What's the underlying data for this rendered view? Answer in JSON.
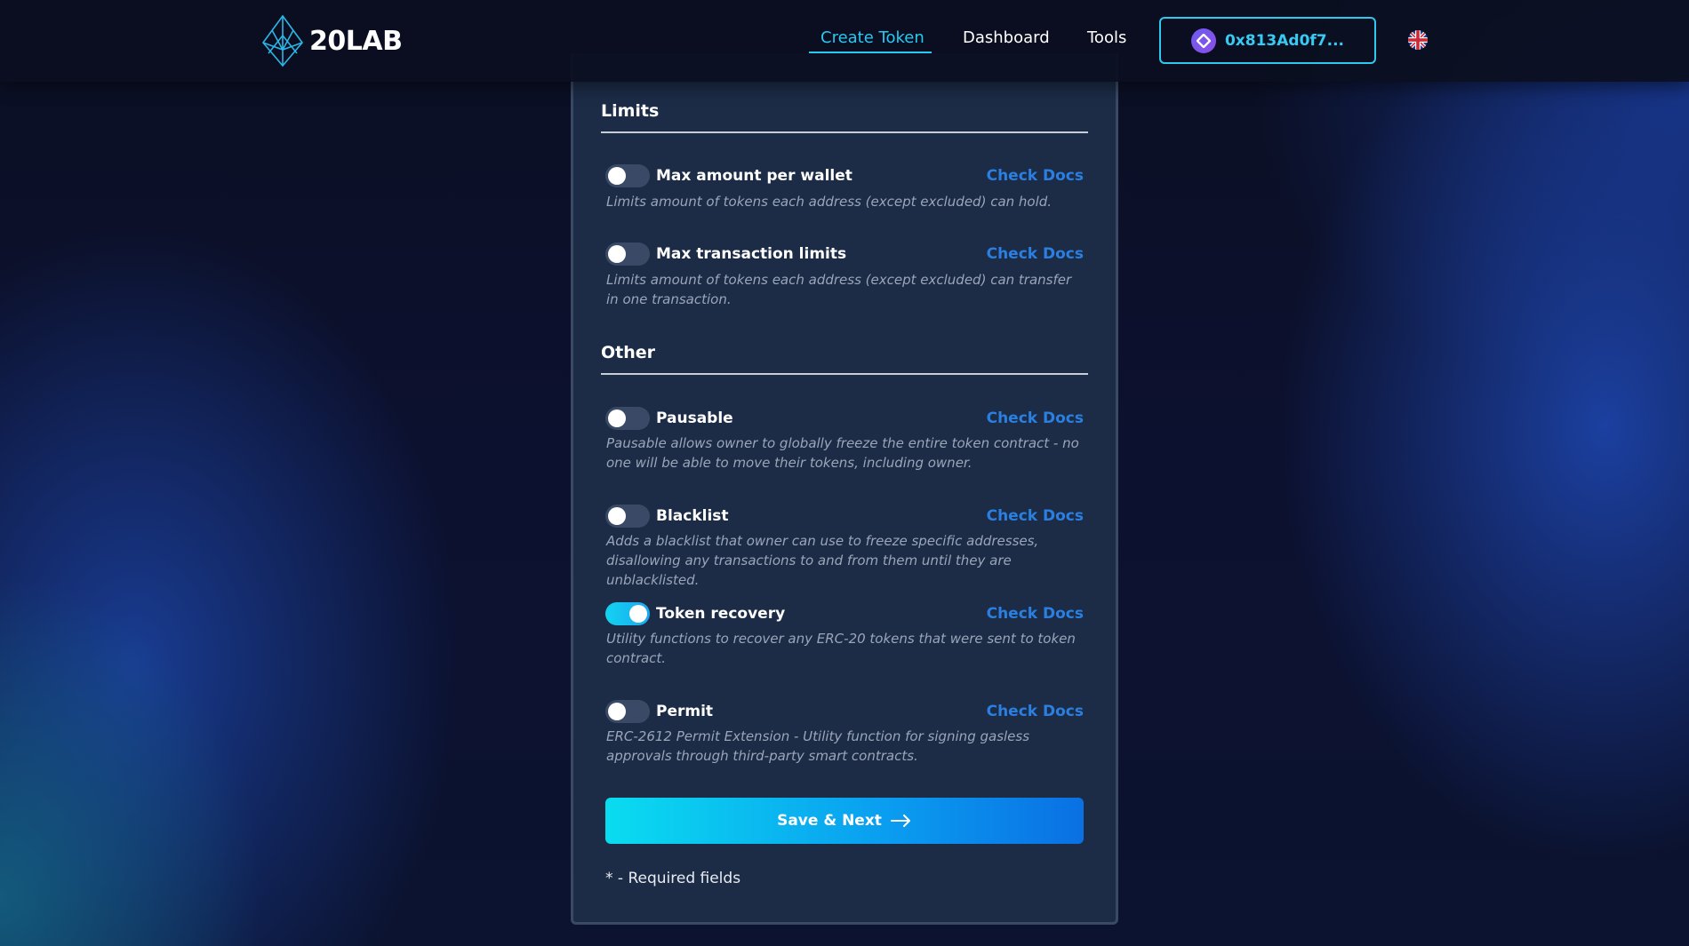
{
  "header": {
    "logo_text": "20LAB",
    "nav": [
      {
        "label": "Create Token",
        "active": true
      },
      {
        "label": "Dashboard",
        "active": false
      },
      {
        "label": "Tools",
        "active": false
      }
    ],
    "wallet_address": "0x813Ad0f7...",
    "language_icon": "uk-flag-icon"
  },
  "limits": {
    "title": "Limits",
    "options": [
      {
        "label": "Max amount per wallet",
        "docs": "Check Docs",
        "desc": "Limits amount of tokens each address (except excluded) can hold.",
        "enabled": false
      },
      {
        "label": "Max transaction limits",
        "docs": "Check Docs",
        "desc": "Limits amount of tokens each address (except excluded) can transfer in one transaction.",
        "enabled": false
      }
    ]
  },
  "other": {
    "title": "Other",
    "options": [
      {
        "label": "Pausable",
        "docs": "Check Docs",
        "desc": "Pausable allows owner to globally freeze the entire token contract - no one will be able to move their tokens, including owner.",
        "enabled": false
      },
      {
        "label": "Blacklist",
        "docs": "Check Docs",
        "desc": "Adds a blacklist that owner can use to freeze specific addresses, disallowing any transactions to and from them until they are unblacklisted.",
        "enabled": false
      },
      {
        "label": "Token recovery",
        "docs": "Check Docs",
        "desc": "Utility functions to recover any ERC-20 tokens that were sent to token contract.",
        "enabled": true
      },
      {
        "label": "Permit",
        "docs": "Check Docs",
        "desc": "ERC-2612 Permit Extension - Utility function for signing gasless approvals through third-party smart contracts.",
        "enabled": false
      }
    ]
  },
  "footer": {
    "save_label": "Save & Next",
    "required_note": "* - Required fields"
  },
  "colors": {
    "accent": "#27c9f0",
    "link": "#2a7fe0",
    "card": "#1c2c47"
  }
}
